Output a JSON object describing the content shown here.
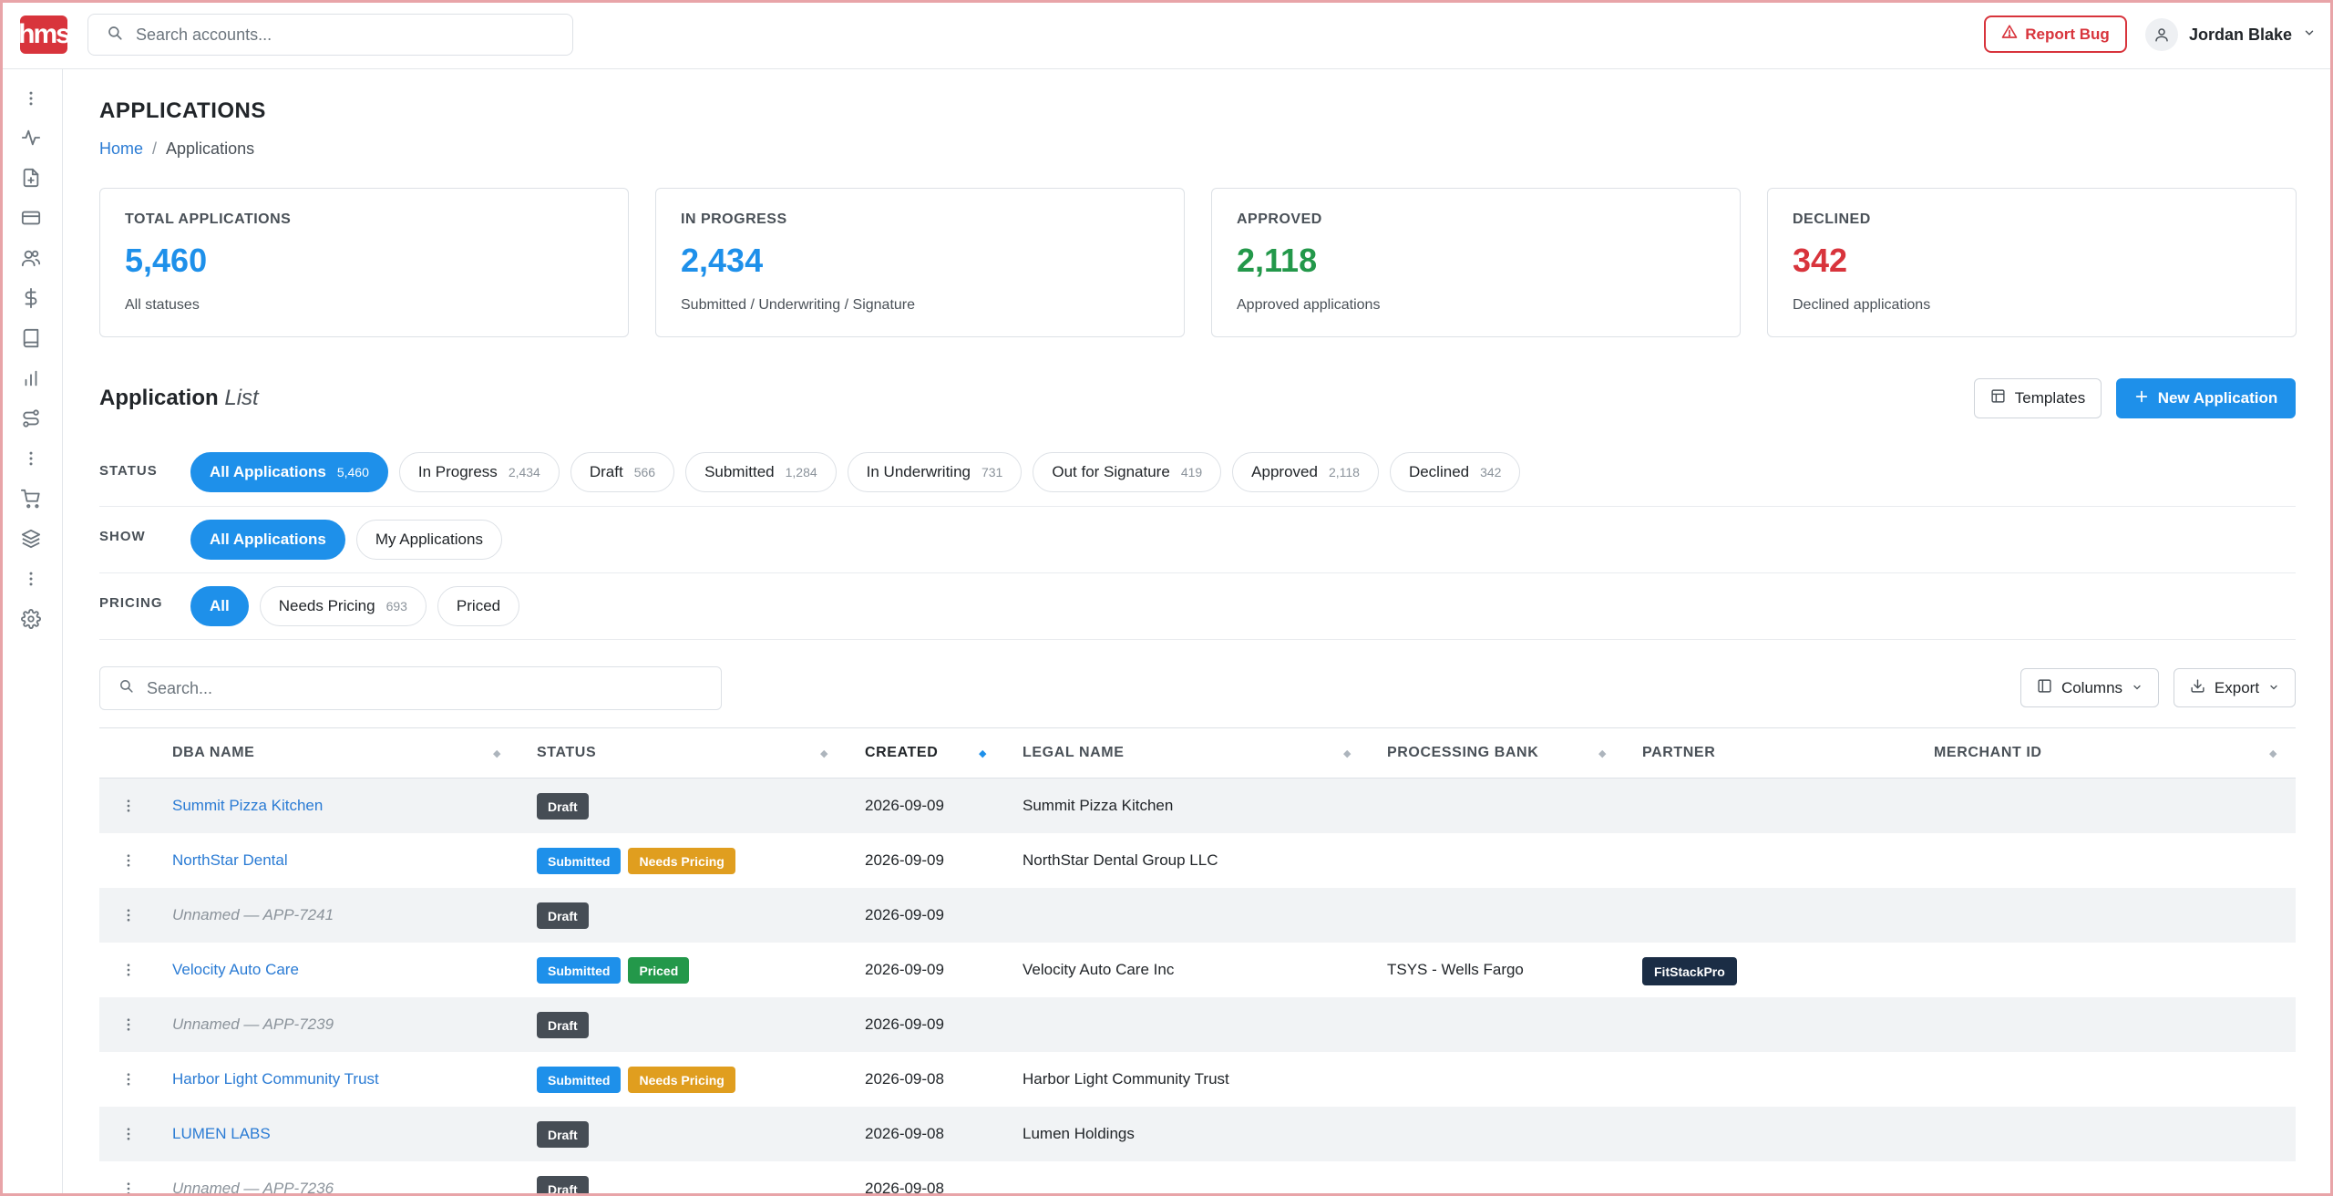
{
  "brand": {
    "logo_text": "hms",
    "accent": "#d8343c",
    "primary": "#1e90ea"
  },
  "header": {
    "search_placeholder": "Search accounts...",
    "report_bug_label": "Report Bug",
    "user_name": "Jordan Blake"
  },
  "sidebar": {
    "icons": [
      "more-vertical-icon",
      "activity-icon",
      "file-plus-icon",
      "credit-card-icon",
      "users-icon",
      "dollar-icon",
      "book-icon",
      "bar-chart-icon",
      "route-icon",
      "more-vertical-icon",
      "cart-icon",
      "layers-icon",
      "more-vertical-icon",
      "gear-icon"
    ]
  },
  "page": {
    "title": "APPLICATIONS",
    "breadcrumb": {
      "home": "Home",
      "separator": "/",
      "current": "Applications"
    }
  },
  "stats": [
    {
      "label": "TOTAL APPLICATIONS",
      "value": "5,460",
      "sub": "All statuses",
      "color": "#1e90ea"
    },
    {
      "label": "IN PROGRESS",
      "value": "2,434",
      "sub": "Submitted / Underwriting / Signature",
      "color": "#1e90ea"
    },
    {
      "label": "APPROVED",
      "value": "2,118",
      "sub": "Approved applications",
      "color": "#23984a"
    },
    {
      "label": "DECLINED",
      "value": "342",
      "sub": "Declined applications",
      "color": "#d8343c"
    }
  ],
  "list": {
    "title_bold": "Application",
    "title_italic": "List",
    "templates_label": "Templates",
    "new_label": "New Application"
  },
  "filters": {
    "status": {
      "label": "STATUS",
      "pills": [
        {
          "label": "All Applications",
          "count": "5,460",
          "active": true
        },
        {
          "label": "In Progress",
          "count": "2,434"
        },
        {
          "label": "Draft",
          "count": "566"
        },
        {
          "label": "Submitted",
          "count": "1,284"
        },
        {
          "label": "In Underwriting",
          "count": "731"
        },
        {
          "label": "Out for Signature",
          "count": "419"
        },
        {
          "label": "Approved",
          "count": "2,118"
        },
        {
          "label": "Declined",
          "count": "342"
        }
      ]
    },
    "show": {
      "label": "SHOW",
      "pills": [
        {
          "label": "All Applications",
          "count": "",
          "active": true
        },
        {
          "label": "My Applications",
          "count": ""
        }
      ]
    },
    "pricing": {
      "label": "PRICING",
      "pills": [
        {
          "label": "All",
          "count": "",
          "active": true
        },
        {
          "label": "Needs Pricing",
          "count": "693"
        },
        {
          "label": "Priced",
          "count": ""
        }
      ]
    }
  },
  "table_tools": {
    "search_placeholder": "Search...",
    "columns_label": "Columns",
    "export_label": "Export"
  },
  "table": {
    "columns": [
      "DBA NAME",
      "STATUS",
      "CREATED",
      "LEGAL NAME",
      "PROCESSING BANK",
      "PARTNER",
      "MERCHANT ID"
    ],
    "sorted_column": "CREATED",
    "status_colors": {
      "Draft": "#464d55",
      "Submitted": "#1e90ea",
      "Needs Pricing": "#e09e1f",
      "Priced": "#23984a"
    },
    "rows": [
      {
        "dba": "Summit Pizza Kitchen",
        "unnamed": false,
        "statuses": [
          "Draft"
        ],
        "created": "2026-09-09",
        "legal": "Summit Pizza Kitchen",
        "bank": "",
        "partner": "",
        "merchant_id": ""
      },
      {
        "dba": "NorthStar Dental",
        "unnamed": false,
        "statuses": [
          "Submitted",
          "Needs Pricing"
        ],
        "created": "2026-09-09",
        "legal": "NorthStar Dental Group LLC",
        "bank": "",
        "partner": "",
        "merchant_id": ""
      },
      {
        "dba": "Unnamed — APP-7241",
        "unnamed": true,
        "statuses": [
          "Draft"
        ],
        "created": "2026-09-09",
        "legal": "",
        "bank": "",
        "partner": "",
        "merchant_id": ""
      },
      {
        "dba": "Velocity Auto Care",
        "unnamed": false,
        "statuses": [
          "Submitted",
          "Priced"
        ],
        "created": "2026-09-09",
        "legal": "Velocity Auto Care Inc",
        "bank": "TSYS - Wells Fargo",
        "partner": "FitStackPro",
        "merchant_id": ""
      },
      {
        "dba": "Unnamed — APP-7239",
        "unnamed": true,
        "statuses": [
          "Draft"
        ],
        "created": "2026-09-09",
        "legal": "",
        "bank": "",
        "partner": "",
        "merchant_id": ""
      },
      {
        "dba": "Harbor Light Community Trust",
        "unnamed": false,
        "statuses": [
          "Submitted",
          "Needs Pricing"
        ],
        "created": "2026-09-08",
        "legal": "Harbor Light Community Trust",
        "bank": "",
        "partner": "",
        "merchant_id": ""
      },
      {
        "dba": "LUMEN LABS",
        "unnamed": false,
        "statuses": [
          "Draft"
        ],
        "created": "2026-09-08",
        "legal": "Lumen Holdings",
        "bank": "",
        "partner": "",
        "merchant_id": ""
      },
      {
        "dba": "Unnamed — APP-7236",
        "unnamed": true,
        "statuses": [
          "Draft"
        ],
        "created": "2026-09-08",
        "legal": "",
        "bank": "",
        "partner": "",
        "merchant_id": ""
      }
    ]
  }
}
